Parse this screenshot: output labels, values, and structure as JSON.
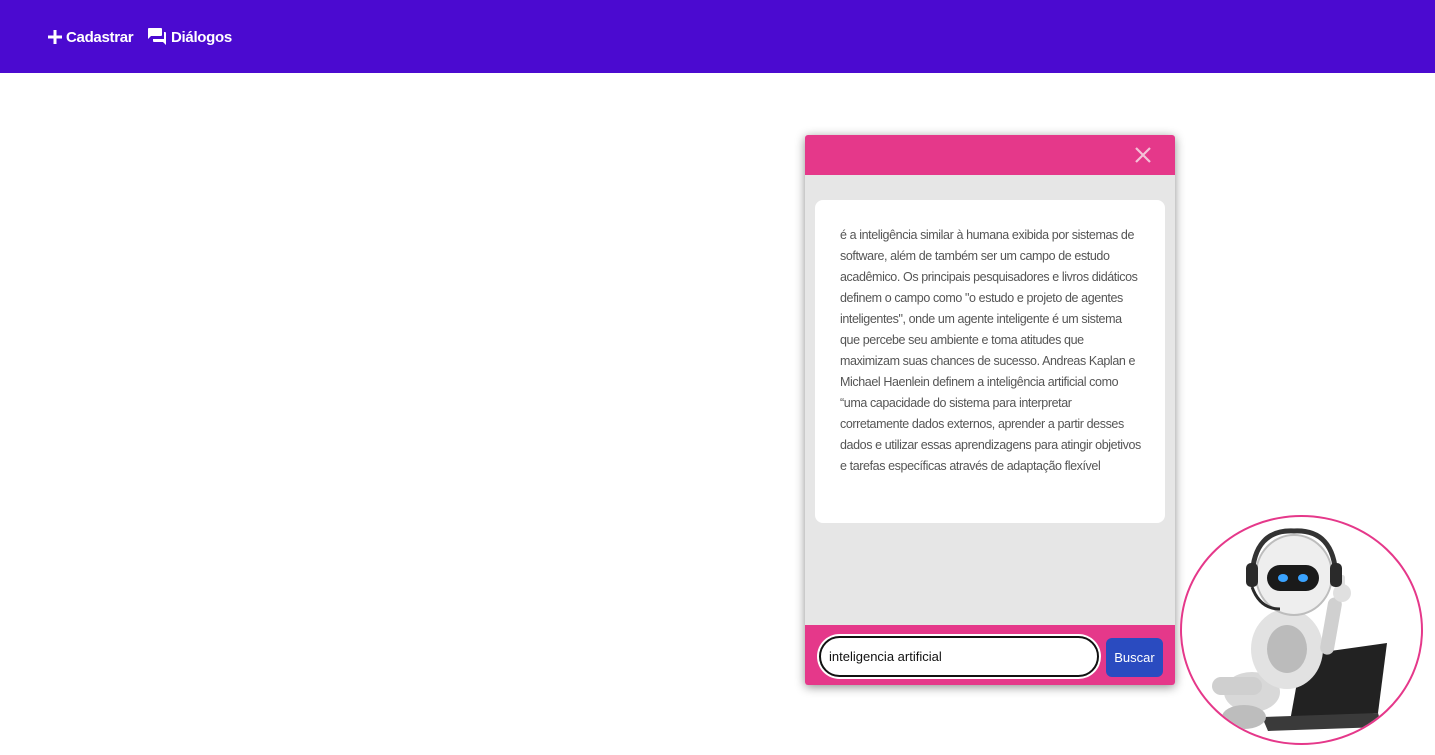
{
  "nav": {
    "items": [
      {
        "label": "Cadastrar",
        "icon": "plus-icon"
      },
      {
        "label": "Diálogos",
        "icon": "chat-bubbles-icon"
      }
    ]
  },
  "chat": {
    "close_icon": "close-icon",
    "response_text": "é a inteligência similar à humana exibida por sistemas de software, além de também ser um campo de estudo acadêmico. Os principais pesquisadores e livros didáticos definem o campo como \"o estudo e projeto de agentes inteligentes\", onde um agente inteligente é um sistema que percebe seu ambiente e toma atitudes que maximizam suas chances de sucesso. Andreas Kaplan e Michael Haenlein definem a inteligência artificial como “uma capacidade do sistema para interpretar corretamente dados externos, aprender a partir desses dados e utilizar essas aprendizagens para atingir objetivos e tarefas específicas através de adaptação flexível",
    "input_value": "inteligencia artificial",
    "search_label": "Buscar"
  },
  "colors": {
    "topbar": "#4b0ad0",
    "accent": "#e5388a",
    "button": "#2a4bc0",
    "panel": "#e6e6e6"
  },
  "avatar": {
    "icon": "robot-assistant-icon"
  }
}
